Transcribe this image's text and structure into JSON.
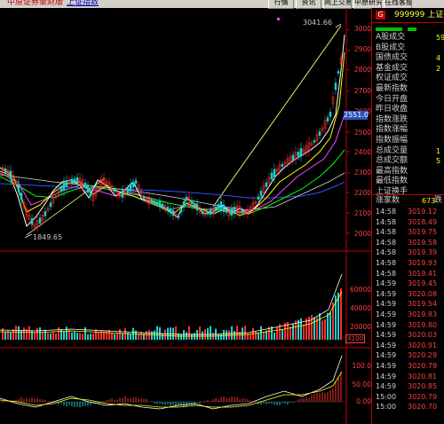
{
  "topbar": {
    "broker_link": "中原证券聚财版",
    "index_link": "上证指数",
    "buttons": [
      "行情",
      "资讯",
      "网上交易",
      "中原研究",
      "在线客服"
    ]
  },
  "chart": {
    "high_label": "3041.66",
    "low_label": "1849.65",
    "current_price_tag": "2551.0",
    "price_axis": [
      "3000",
      "2900",
      "2800",
      "2700",
      "2600",
      "2500",
      "2400",
      "2300",
      "2200",
      "2100",
      "2000"
    ],
    "volume_axis": [
      "60000",
      "40000",
      "20000"
    ],
    "volume_unit": "X100",
    "macd_axis": [
      "100.0",
      "50.00",
      "0.00"
    ],
    "colors": {
      "up": "#ff3030",
      "down": "#20d0d0",
      "ma5": "#ffffff",
      "ma10": "#ffff00",
      "ma20": "#ff40ff",
      "ma30": "#00ff00",
      "ma60": "#3050ff",
      "ma120": "#e0e0e0"
    }
  },
  "panel": {
    "code": "999999",
    "name": "上证指",
    "badge": "G",
    "indicators": [
      {
        "label": "A股成交",
        "value": "59"
      },
      {
        "label": "B股成交",
        "value": ""
      },
      {
        "label": "国债成交",
        "value": "4"
      },
      {
        "label": "基金成交",
        "value": "2"
      },
      {
        "label": "权证成交",
        "value": ""
      },
      {
        "label": "最新指数",
        "value": ""
      },
      {
        "label": "今日开盘",
        "value": ""
      },
      {
        "label": "昨日收盘",
        "value": ""
      },
      {
        "label": "指数涨跌",
        "value": ""
      },
      {
        "label": "指数涨幅",
        "value": ""
      },
      {
        "label": "指数振幅",
        "value": ""
      },
      {
        "label": "总成交量",
        "value": "1"
      },
      {
        "label": "总成交额",
        "value": "5"
      },
      {
        "label": "最高指数",
        "value": ""
      },
      {
        "label": "最低指数",
        "value": ""
      },
      {
        "label": "上证换手",
        "value": ""
      }
    ],
    "tick_header": {
      "label": "涨家数",
      "count": "673",
      "label2": "跌"
    },
    "ticks": [
      {
        "time": "14:58",
        "price": "3019.12"
      },
      {
        "time": "14:58",
        "price": "3018.49"
      },
      {
        "time": "14:58",
        "price": "3019.75"
      },
      {
        "time": "14:58",
        "price": "3019.58"
      },
      {
        "time": "14:58",
        "price": "3019.39"
      },
      {
        "time": "14:58",
        "price": "3019.93"
      },
      {
        "time": "14:58",
        "price": "3019.41"
      },
      {
        "time": "14:59",
        "price": "3019.45"
      },
      {
        "time": "14:59",
        "price": "3020.08"
      },
      {
        "time": "14:59",
        "price": "3019.54"
      },
      {
        "time": "14:59",
        "price": "3019.83"
      },
      {
        "time": "14:59",
        "price": "3019.80"
      },
      {
        "time": "14:59",
        "price": "3020.03"
      },
      {
        "time": "14:59",
        "price": "3020.91"
      },
      {
        "time": "14:59",
        "price": "3020.29"
      },
      {
        "time": "14:59",
        "price": "3020.79"
      },
      {
        "time": "14:59",
        "price": "3020.81"
      },
      {
        "time": "14:59",
        "price": "3020.85"
      },
      {
        "time": "15:00",
        "price": "3020.79"
      },
      {
        "time": "15:00",
        "price": "3020.70"
      }
    ]
  }
}
